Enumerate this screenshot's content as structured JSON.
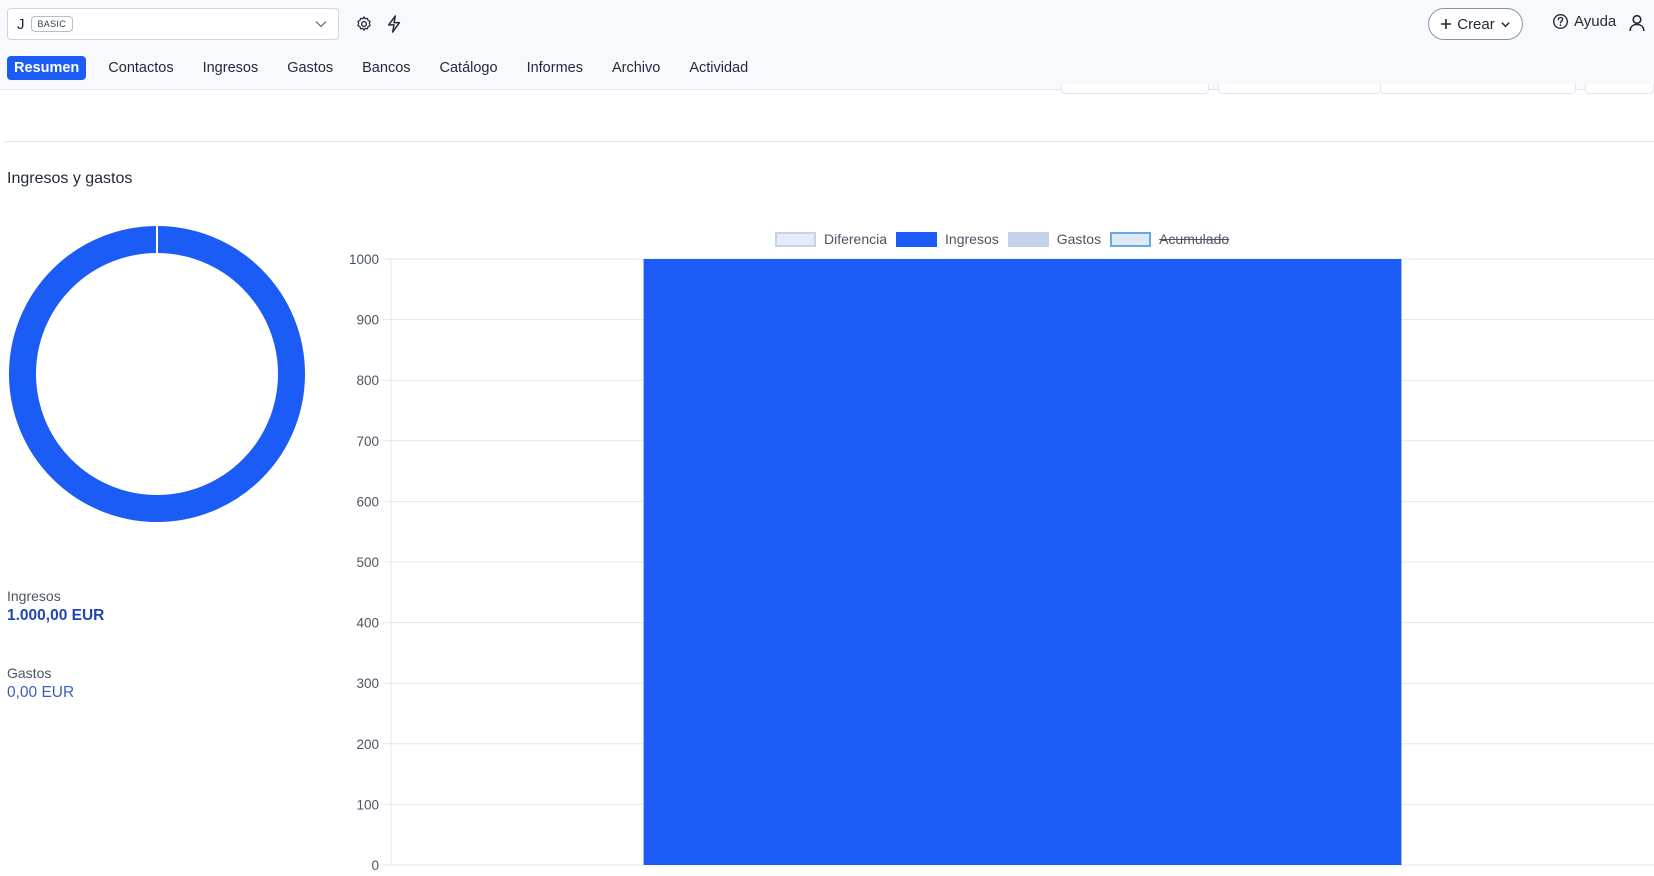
{
  "header": {
    "company_initial": "J",
    "plan_badge": "BASIC",
    "create_label": "Crear",
    "help_label": "Ayuda"
  },
  "tabs": [
    {
      "label": "Resumen",
      "active": true
    },
    {
      "label": "Contactos"
    },
    {
      "label": "Ingresos"
    },
    {
      "label": "Gastos"
    },
    {
      "label": "Bancos"
    },
    {
      "label": "Catálogo"
    },
    {
      "label": "Informes"
    },
    {
      "label": "Archivo"
    },
    {
      "label": "Actividad"
    }
  ],
  "section": {
    "title": "Ingresos y gastos"
  },
  "summary": {
    "income_label": "Ingresos",
    "income_value": "1.000,00 EUR",
    "expense_label": "Gastos",
    "expense_value": "0,00 EUR"
  },
  "colors": {
    "primary": "#1a5cf5",
    "diferencia": "#e6ecf7",
    "gastos": "#c5d2ea",
    "acumulado": "#dde9f7"
  },
  "donut_data": {
    "type": "pie",
    "values": [
      1000,
      0
    ],
    "colors": [
      "#1a5cf5",
      "#c5d2ea"
    ]
  },
  "chart_data": {
    "type": "bar",
    "categories": [
      ""
    ],
    "series": [
      {
        "name": "Diferencia",
        "values": [
          0
        ],
        "color": "#e6ecf7",
        "hidden": false
      },
      {
        "name": "Ingresos",
        "values": [
          1000
        ],
        "color": "#1a5cf5",
        "hidden": false
      },
      {
        "name": "Gastos",
        "values": [
          0
        ],
        "color": "#c5d2ea",
        "hidden": false
      },
      {
        "name": "Acumulado",
        "values": [
          0
        ],
        "color": "#dde9f7",
        "hidden": true
      }
    ],
    "yticks": [
      0,
      100,
      200,
      300,
      400,
      500,
      600,
      700,
      800,
      900,
      1000
    ],
    "ylim": [
      0,
      1000
    ],
    "grid": true,
    "legend_position": "top-center"
  }
}
